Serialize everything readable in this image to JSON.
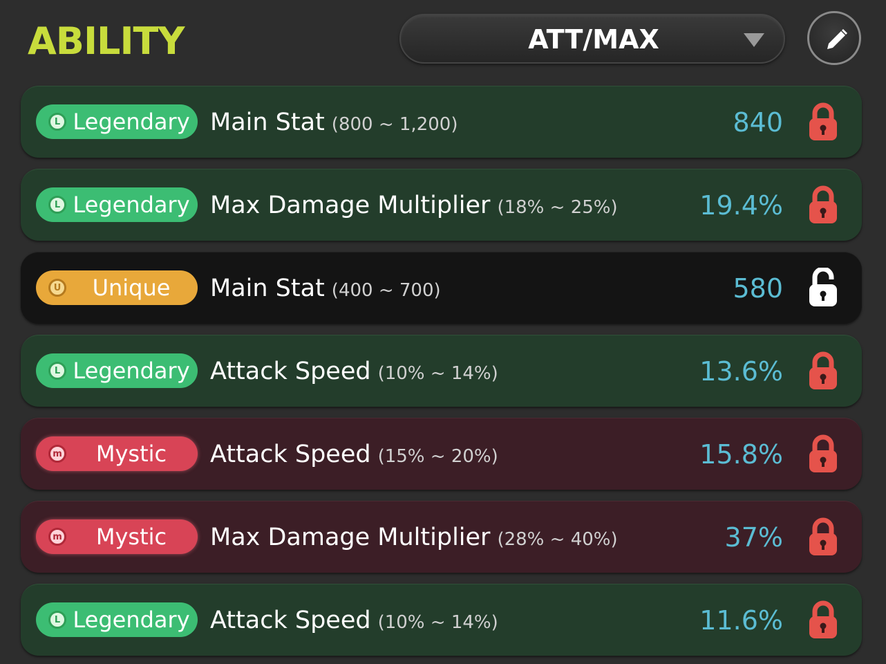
{
  "header": {
    "title": "ABILITY",
    "preset_label": "ATT/MAX"
  },
  "colors": {
    "title": "#c8dc3c",
    "value": "#5bbcd3",
    "legendary": "#3cbd73",
    "unique": "#e8a83a",
    "mystic": "#d84456",
    "lock_locked": "#e5534b",
    "lock_unlocked": "#ffffff"
  },
  "abilities": [
    {
      "tier": "Legendary",
      "tier_icon": "L",
      "stat": "Main Stat",
      "range": "(800 ~ 1,200)",
      "value": "840",
      "locked": true
    },
    {
      "tier": "Legendary",
      "tier_icon": "L",
      "stat": "Max Damage Multiplier",
      "range": "(18% ~ 25%)",
      "value": "19.4%",
      "locked": true
    },
    {
      "tier": "Unique",
      "tier_icon": "U",
      "stat": "Main Stat",
      "range": "(400 ~ 700)",
      "value": "580",
      "locked": false
    },
    {
      "tier": "Legendary",
      "tier_icon": "L",
      "stat": "Attack Speed",
      "range": "(10% ~ 14%)",
      "value": "13.6%",
      "locked": true
    },
    {
      "tier": "Mystic",
      "tier_icon": "m",
      "stat": "Attack Speed",
      "range": "(15% ~ 20%)",
      "value": "15.8%",
      "locked": true
    },
    {
      "tier": "Mystic",
      "tier_icon": "m",
      "stat": "Max Damage Multiplier",
      "range": "(28% ~ 40%)",
      "value": "37%",
      "locked": true
    },
    {
      "tier": "Legendary",
      "tier_icon": "L",
      "stat": "Attack Speed",
      "range": "(10% ~ 14%)",
      "value": "11.6%",
      "locked": true
    }
  ]
}
